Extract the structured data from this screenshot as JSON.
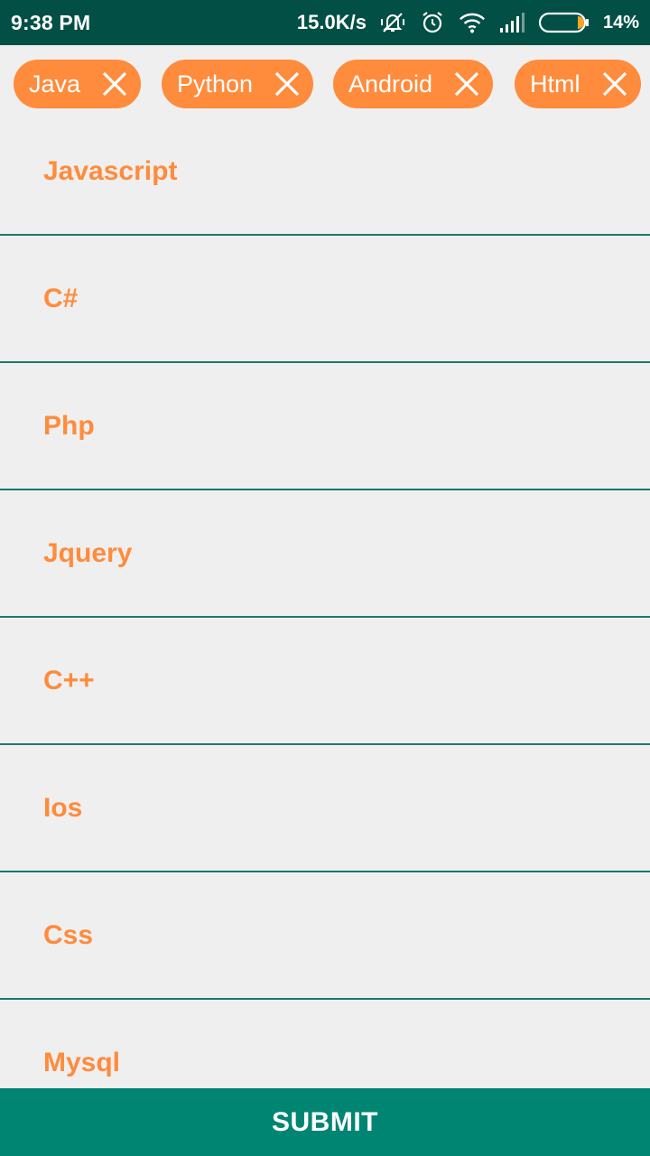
{
  "status_bar": {
    "time": "9:38 PM",
    "net_speed": "15.0K/s",
    "battery_percent": "14%",
    "icons": [
      "mute-icon",
      "alarm-icon",
      "wifi-icon",
      "signal-icon",
      "battery-icon"
    ]
  },
  "chips": [
    {
      "label": "Java",
      "icon": "close-icon"
    },
    {
      "label": "Python",
      "icon": "close-icon"
    },
    {
      "label": "Android",
      "icon": "close-icon"
    },
    {
      "label": "Html",
      "icon": "close-icon"
    }
  ],
  "list": {
    "items": [
      {
        "label": "Javascript"
      },
      {
        "label": "C#"
      },
      {
        "label": "Php"
      },
      {
        "label": "Jquery"
      },
      {
        "label": "C++"
      },
      {
        "label": "Ios"
      },
      {
        "label": "Css"
      },
      {
        "label": "Mysql"
      }
    ]
  },
  "submit": {
    "label": "SUBMIT"
  },
  "colors": {
    "status_bar_bg": "#024f45",
    "accent_orange": "#ff8b3d",
    "submit_bg": "#008573",
    "divider": "#1c7a68",
    "background": "#efefef"
  }
}
